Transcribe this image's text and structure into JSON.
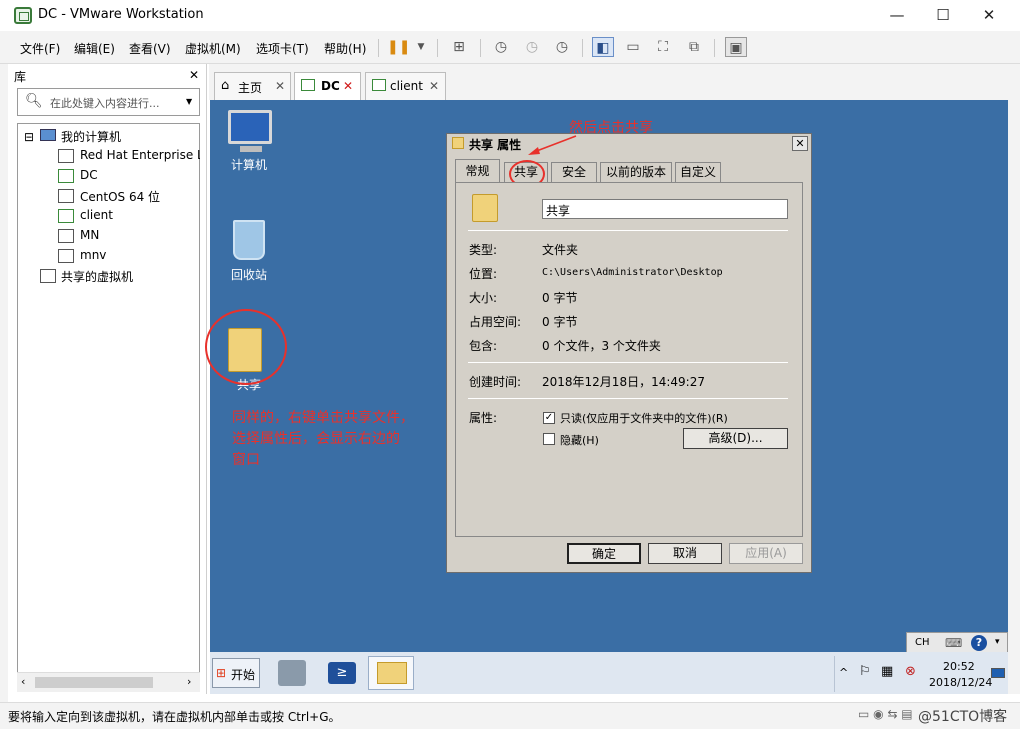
{
  "window": {
    "title": "DC - VMware Workstation",
    "minimize": "—",
    "maximize": "☐",
    "close": "✕"
  },
  "menu": {
    "items": [
      "文件(F)",
      "编辑(E)",
      "查看(V)",
      "虚拟机(M)",
      "选项卡(T)",
      "帮助(H)"
    ]
  },
  "library": {
    "title": "库",
    "close": "✕",
    "search_placeholder": "在此处键入内容进行...",
    "tree_root": "我的计算机",
    "vms": [
      "Red Hat Enterprise L",
      "DC",
      "CentOS 64 位",
      "client",
      "MN",
      "mnv"
    ],
    "shared": "共享的虚拟机"
  },
  "tabs": [
    {
      "label": "主页",
      "close": "✕"
    },
    {
      "label": "DC",
      "close": "✕"
    },
    {
      "label": "client",
      "close": "✕"
    }
  ],
  "desktop": {
    "icons": [
      "计算机",
      "回收站",
      "共享"
    ],
    "annotation_left": [
      "同样的，右键单击共享文件，",
      "选择属性后，会显示右边的",
      "窗口"
    ],
    "annotation_top": "然后点击共享"
  },
  "dialog": {
    "title": "共享 属性",
    "tabs": [
      "常规",
      "共享",
      "安全",
      "以前的版本",
      "自定义"
    ],
    "name_value": "共享",
    "fields": [
      {
        "label": "类型:",
        "value": "文件夹"
      },
      {
        "label": "位置:",
        "value": "C:\\Users\\Administrator\\Desktop"
      },
      {
        "label": "大小:",
        "value": "0 字节"
      },
      {
        "label": "占用空间:",
        "value": "0 字节"
      },
      {
        "label": "包含:",
        "value": "0 个文件，3 个文件夹"
      }
    ],
    "created_label": "创建时间:",
    "created_value": "2018年12月18日，14:49:27",
    "attr_label": "属性:",
    "readonly_label": "只读(仅应用于文件夹中的文件)(R)",
    "hidden_label": "隐藏(H)",
    "advanced_button": "高级(D)...",
    "ok": "确定",
    "cancel": "取消",
    "apply": "应用(A)"
  },
  "vm_taskbar": {
    "start": "开始",
    "time": "20:52",
    "date": "2018/12/24",
    "lang": "CH",
    "help": "?"
  },
  "status": {
    "text": "要将输入定向到该虚拟机，请在虚拟机内部单击或按 Ctrl+G。",
    "watermark": "@51CTO博客"
  }
}
